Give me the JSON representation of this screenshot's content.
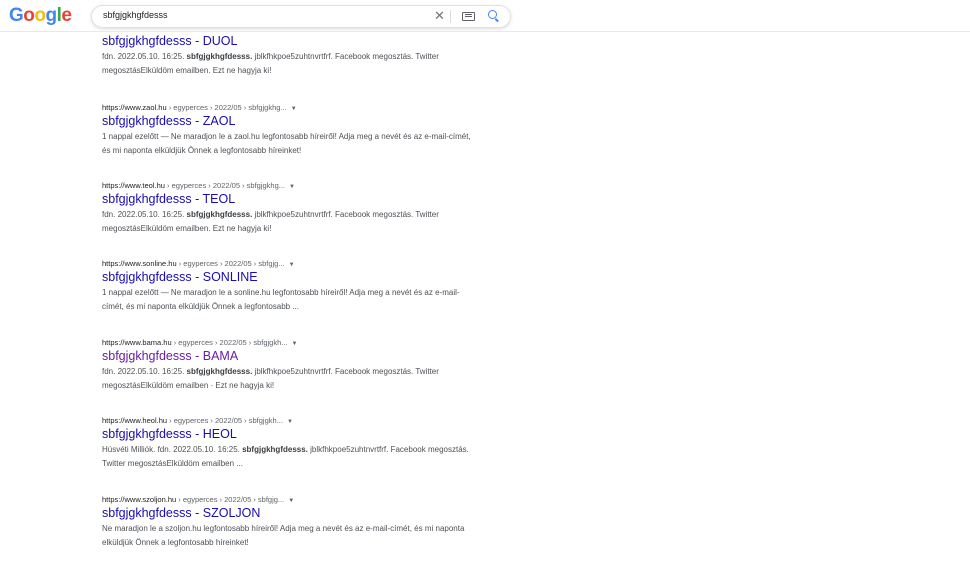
{
  "header": {
    "logo_letters": [
      {
        "ch": "G",
        "color": "#4285f4"
      },
      {
        "ch": "o",
        "color": "#ea4335"
      },
      {
        "ch": "o",
        "color": "#fbbc05"
      },
      {
        "ch": "g",
        "color": "#4285f4"
      },
      {
        "ch": "l",
        "color": "#34a853"
      },
      {
        "ch": "e",
        "color": "#ea4335"
      }
    ],
    "search_value": "sbfgjgkhgfdesss",
    "clear_glyph": "✕"
  },
  "results": [
    {
      "cite_site": "",
      "cite_path": "",
      "title": "sbfgjgkhgfdesss - DUOL",
      "visited": false,
      "snippet_pre": "fdn. 2022.05.10. 16:25. ",
      "snippet_hl": "sbfgjgkhgfdesss.",
      "snippet_post": " jblkfhkpoe5zuhtnvrtfrf. Facebook megosztás. Twitter megosztásElküldöm emailben. Ezt ne hagyja ki!"
    },
    {
      "cite_site": "https://www.zaol.hu",
      "cite_path": " › egyperces › 2022/05 › sbfgjgkhg...",
      "title": "sbfgjgkhgfdesss - ZAOL",
      "visited": false,
      "snippet_pre": "1 nappal ezelőtt — Ne maradjon le a zaol.hu legfontosabb híreiről! Adja meg a nevét és az e-mail-címét, és mi naponta elküldjük Önnek a legfontosabb híreinket!",
      "snippet_hl": "",
      "snippet_post": ""
    },
    {
      "cite_site": "https://www.teol.hu",
      "cite_path": " › egyperces › 2022/05 › sbfgjgkhg...",
      "title": "sbfgjgkhgfdesss - TEOL",
      "visited": false,
      "snippet_pre": "fdn. 2022.05.10. 16:25. ",
      "snippet_hl": "sbfgjgkhgfdesss.",
      "snippet_post": " jblkfhkpoe5zuhtnvrtfrf. Facebook megosztás. Twitter megosztásElküldöm emailben. Ezt ne hagyja ki!"
    },
    {
      "cite_site": "https://www.sonline.hu",
      "cite_path": " › egyperces › 2022/05 › sbfgjg...",
      "title": "sbfgjgkhgfdesss - SONLINE",
      "visited": false,
      "snippet_pre": "1 nappal ezelőtt — Ne maradjon le a sonline.hu legfontosabb híreiről! Adja meg a nevét és az e-mail-címét, és mi naponta elküldjük Önnek a legfontosabb ...",
      "snippet_hl": "",
      "snippet_post": ""
    },
    {
      "cite_site": "https://www.bama.hu",
      "cite_path": " › egyperces › 2022/05 › sbfgjgkh...",
      "title": "sbfgjgkhgfdesss - BAMA",
      "visited": true,
      "snippet_pre": "fdn. 2022.05.10. 16:25. ",
      "snippet_hl": "sbfgjgkhgfdesss.",
      "snippet_post": " jblkfhkpoe5zuhtnvrtfrf. Facebook megosztás. Twitter megosztásElküldöm emailben · Ezt ne hagyja ki!"
    },
    {
      "cite_site": "https://www.heol.hu",
      "cite_path": " › egyperces › 2022/05 › sbfgjgkh...",
      "title": "sbfgjgkhgfdesss - HEOL",
      "visited": false,
      "snippet_pre": "Húsvéti Milliók. fdn. 2022.05.10. 16:25. ",
      "snippet_hl": "sbfgjgkhgfdesss.",
      "snippet_post": " jblkfhkpoe5zuhtnvrtfrf. Facebook megosztás. Twitter megosztásElküldöm emailben ..."
    },
    {
      "cite_site": "https://www.szoljon.hu",
      "cite_path": " › egyperces › 2022/05 › sbfgjg...",
      "title": "sbfgjgkhgfdesss - SZOLJON",
      "visited": false,
      "snippet_pre": "Ne maradjon le a szoljon.hu legfontosabb híreiről! Adja meg a nevét és az e-mail-címét, és mi naponta elküldjük Önnek a legfontosabb híreinket!",
      "snippet_hl": "",
      "snippet_post": ""
    }
  ],
  "caret_glyph": "▼"
}
